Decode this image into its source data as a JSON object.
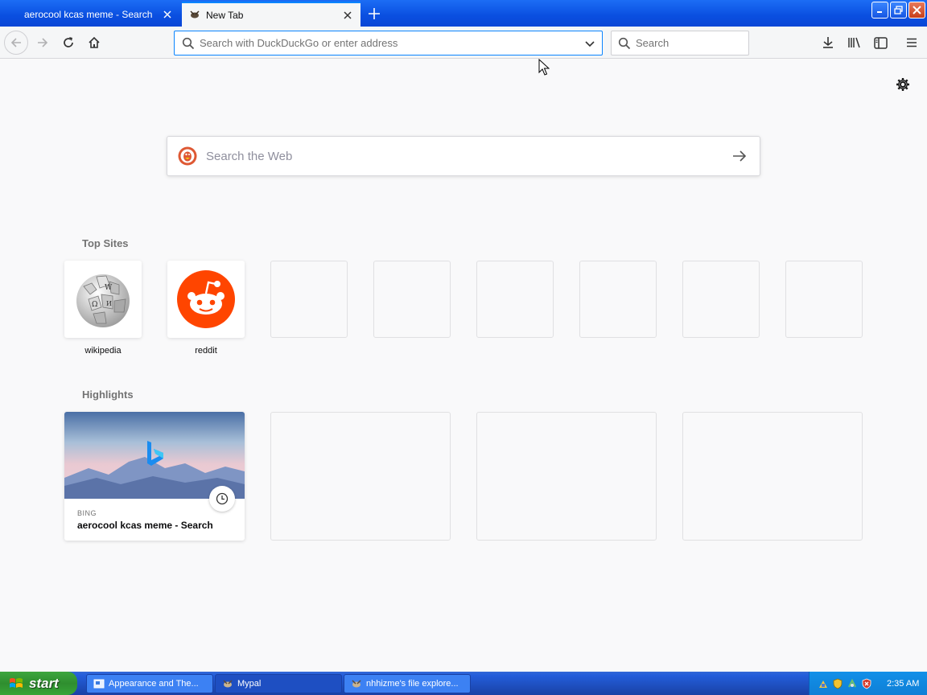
{
  "tabs": [
    {
      "title": "aerocool kcas meme - Search",
      "active": false
    },
    {
      "title": "New Tab",
      "active": true
    }
  ],
  "navbar": {
    "url_placeholder": "Search with DuckDuckGo or enter address",
    "search_placeholder": "Search"
  },
  "newtab": {
    "web_search_placeholder": "Search the Web",
    "top_sites_title": "Top Sites",
    "top_sites": [
      {
        "label": "wikipedia",
        "icon": "wikipedia-globe-icon"
      },
      {
        "label": "reddit",
        "icon": "reddit-alien-icon"
      }
    ],
    "highlights_title": "Highlights",
    "highlight": {
      "host": "BING",
      "title": "aerocool kcas meme - Search",
      "icon": "bing-logo-icon"
    }
  },
  "taskbar": {
    "start_label": "start",
    "buttons": [
      {
        "label": "Appearance and The...",
        "active": false
      },
      {
        "label": "Mypal",
        "active": true
      },
      {
        "label": "nhhizme's file explore...",
        "active": false
      }
    ],
    "clock": "2:35 AM"
  },
  "colors": {
    "accent": "#0a84ff",
    "reddit": "#ff4500",
    "xp_blue": "#245edb",
    "xp_green": "#37a537"
  }
}
